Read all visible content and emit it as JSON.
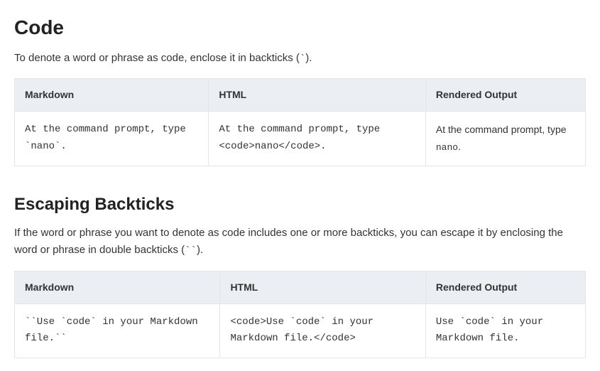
{
  "section1": {
    "title": "Code",
    "desc_pre": "To denote a word or phrase as code, enclose it in backticks (",
    "desc_code": "`",
    "desc_post": ").",
    "headers": [
      "Markdown",
      "HTML",
      "Rendered Output"
    ],
    "row": {
      "markdown": "At the command prompt, type `nano`.",
      "html": "At the command prompt, type <code>nano</code>.",
      "rendered_pre": "At the command prompt, type ",
      "rendered_code": "nano",
      "rendered_post": "."
    }
  },
  "section2": {
    "title": "Escaping Backticks",
    "desc_pre": "If the word or phrase you want to denote as code includes one or more backticks, you can escape it by enclosing the word or phrase in double backticks (",
    "desc_code": "``",
    "desc_post": ").",
    "headers": [
      "Markdown",
      "HTML",
      "Rendered Output"
    ],
    "row": {
      "markdown": "``Use `code` in your Markdown file.``",
      "html": "<code>Use `code` in your Markdown file.</code>",
      "rendered": "Use `code` in your Markdown file."
    }
  }
}
